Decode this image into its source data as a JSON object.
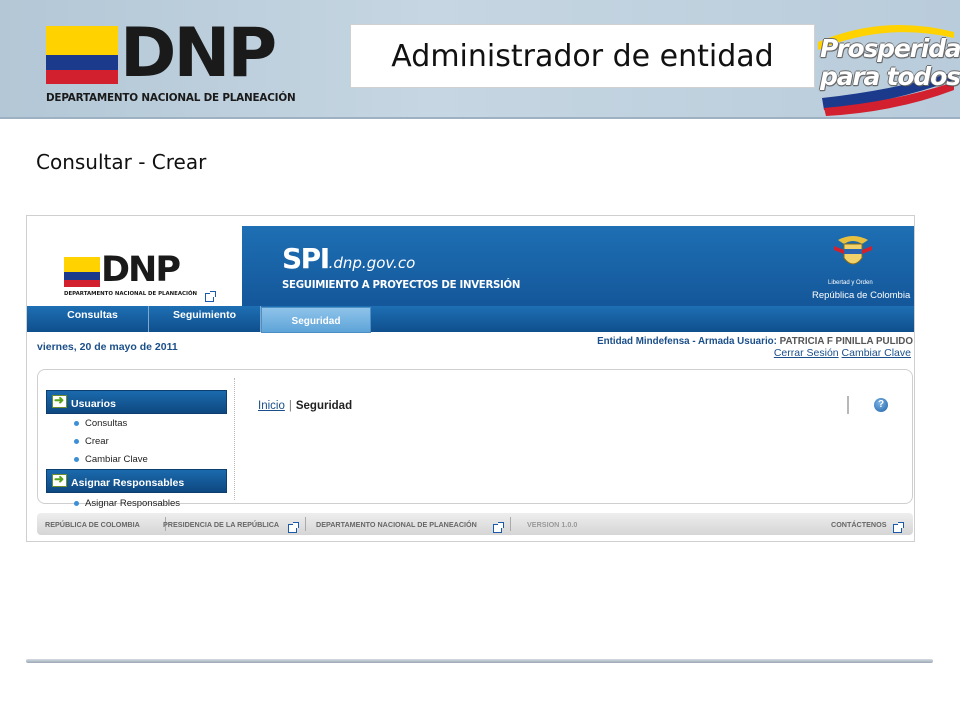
{
  "slide": {
    "logo": {
      "wordmark": "DNP",
      "subtitle": "DEPARTAMENTO NACIONAL DE PLANEACIÓN"
    },
    "title": "Administrador de entidad",
    "tagline": {
      "line1": "Prosperidad",
      "line2": "para todos"
    },
    "subtitle": "Consultar - Crear"
  },
  "app": {
    "logo": {
      "wordmark": "DNP",
      "subtitle": "DEPARTAMENTO NACIONAL DE PLANEACIÓN"
    },
    "banner": {
      "brand": "SPI",
      "domain": ".dnp.gov.co",
      "subtitle": "SEGUIMIENTO A PROYECTOS DE INVERSIÓN",
      "coat_caption": "Libertad y Orden",
      "country": "República de Colombia"
    },
    "nav": {
      "tabs": [
        "Consultas",
        "Seguimiento",
        "Seguridad"
      ],
      "active": "Seguridad"
    },
    "date": "viernes, 20 de mayo de 2011",
    "user": {
      "entity_label": "Entidad Mindefensa - Armada Usuario:",
      "name": "PATRICIA F PINILLA PULIDO",
      "logout": "Cerrar Sesión",
      "change_password": "Cambiar Clave"
    },
    "sidebar": {
      "groups": [
        {
          "label": "Usuarios",
          "items": [
            "Consultas",
            "Crear",
            "Cambiar Clave"
          ]
        },
        {
          "label": "Asignar Responsables",
          "items": [
            "Asignar Responsables"
          ]
        }
      ]
    },
    "breadcrumb": {
      "home": "Inicio",
      "separator": "|",
      "current": "Seguridad"
    },
    "help_icon": "?",
    "footer": {
      "items": [
        "REPÚBLICA DE COLOMBIA",
        "PRESIDENCIA DE LA REPÚBLICA",
        "DEPARTAMENTO NACIONAL DE PLANEACIÓN",
        "VERSION 1.0.0",
        "CONTÁCTENOS"
      ]
    },
    "colors": {
      "banner_blue": "#1e6fb4",
      "link_blue": "#1b4f8a",
      "active_tab": "#8ec3ea",
      "flag_yellow": "#ffd200",
      "flag_blue": "#1b3a8c",
      "flag_red": "#d2202f"
    }
  }
}
